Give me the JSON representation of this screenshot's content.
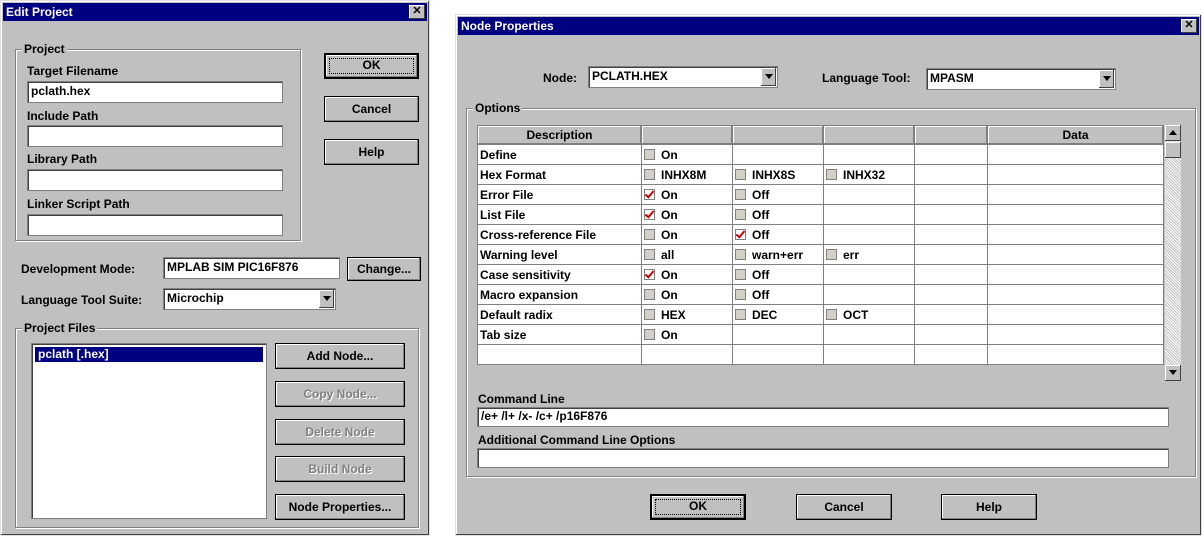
{
  "edit_project": {
    "title": "Edit Project",
    "close": "✕",
    "project_group": "Project",
    "target_filename_label": "Target Filename",
    "target_filename_value": "pclath.hex",
    "include_path_label": "Include Path",
    "include_path_value": "",
    "library_path_label": "Library Path",
    "library_path_value": "",
    "linker_script_label": "Linker Script Path",
    "linker_script_value": "",
    "ok": "OK",
    "cancel": "Cancel",
    "help": "Help",
    "dev_mode_label": "Development Mode:",
    "dev_mode_value": "MPLAB SIM PIC16F876",
    "change": "Change...",
    "lang_suite_label": "Language Tool Suite:",
    "lang_suite_value": "Microchip",
    "project_files_group": "Project Files",
    "files": [
      "pclath [.hex]"
    ],
    "add_node": "Add Node...",
    "copy_node": "Copy Node...",
    "delete_node": "Delete Node",
    "build_node": "Build Node",
    "node_properties": "Node Properties..."
  },
  "node_properties": {
    "title": "Node Properties",
    "close": "✕",
    "node_label": "Node:",
    "node_value": "PCLATH.HEX",
    "lang_tool_label": "Language Tool:",
    "lang_tool_value": "MPASM",
    "options_group": "Options",
    "headers": [
      "Description",
      "",
      "",
      "",
      "",
      "Data"
    ],
    "rows": [
      {
        "desc": "Define",
        "opts": [
          {
            "label": "On",
            "checked": false
          }
        ]
      },
      {
        "desc": "Hex Format",
        "opts": [
          {
            "label": "INHX8M",
            "checked": false
          },
          {
            "label": "INHX8S",
            "checked": false
          },
          {
            "label": "INHX32",
            "checked": false
          }
        ]
      },
      {
        "desc": "Error File",
        "opts": [
          {
            "label": "On",
            "checked": true
          },
          {
            "label": "Off",
            "checked": false
          }
        ]
      },
      {
        "desc": "List File",
        "opts": [
          {
            "label": "On",
            "checked": true
          },
          {
            "label": "Off",
            "checked": false
          }
        ]
      },
      {
        "desc": "Cross-reference File",
        "opts": [
          {
            "label": "On",
            "checked": false
          },
          {
            "label": "Off",
            "checked": true
          }
        ]
      },
      {
        "desc": "Warning level",
        "opts": [
          {
            "label": "all",
            "checked": false
          },
          {
            "label": "warn+err",
            "checked": false
          },
          {
            "label": "err",
            "checked": false
          }
        ]
      },
      {
        "desc": "Case sensitivity",
        "opts": [
          {
            "label": "On",
            "checked": true
          },
          {
            "label": "Off",
            "checked": false
          }
        ]
      },
      {
        "desc": "Macro expansion",
        "opts": [
          {
            "label": "On",
            "checked": false
          },
          {
            "label": "Off",
            "checked": false
          }
        ]
      },
      {
        "desc": "Default radix",
        "opts": [
          {
            "label": "HEX",
            "checked": false
          },
          {
            "label": "DEC",
            "checked": false
          },
          {
            "label": "OCT",
            "checked": false
          }
        ]
      },
      {
        "desc": "Tab size",
        "opts": [
          {
            "label": "On",
            "checked": false
          }
        ]
      },
      {
        "desc": "",
        "opts": []
      }
    ],
    "command_line_label": "Command Line",
    "command_line_value": "/e+ /l+ /x- /c+ /p16F876",
    "additional_label": "Additional Command Line Options",
    "additional_value": "",
    "ok": "OK",
    "cancel": "Cancel",
    "help": "Help"
  }
}
